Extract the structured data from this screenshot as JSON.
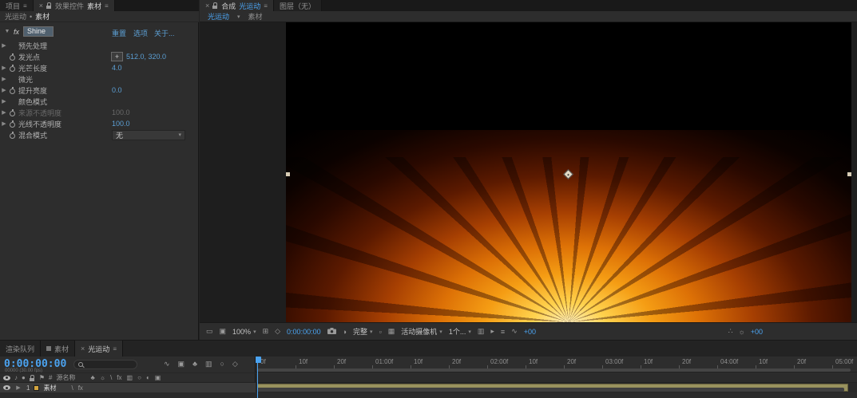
{
  "colors": {
    "accent": "#4ba3f0",
    "value_blue": "#5c9fd4",
    "layer_bar": "#99925e",
    "label_yellow": "#d3a53f",
    "glow_core": "#fff3c8",
    "glow_orange": "#f59d14"
  },
  "icons": {
    "menu": "≡",
    "close": "×",
    "twirl_open": "▼",
    "twirl_closed": "▶",
    "chevron": "▾",
    "bullet": "•",
    "crosshair": "+",
    "screen": "▭",
    "monitor": "▣",
    "grid": "⊞",
    "mask": "◇",
    "snapshot_show": "◎",
    "channels": "◑",
    "roi": "▫",
    "transp": "▦",
    "pixel": "▥",
    "fast": "▸",
    "tl_btn": "≡",
    "flowchart": "∿",
    "mini_flow": "∿",
    "draft3d": "▣",
    "shy": "♣",
    "blend_sw": "▥",
    "mblur": "○",
    "graph": "◇",
    "audio": "♪",
    "solo": "●",
    "flag": "⚑",
    "hash": "#",
    "quality": "\\",
    "fx": "fx",
    "collapse": "☼",
    "adj": "◐",
    "cube": "▣",
    "histogram": "∴",
    "gear": "☼"
  },
  "left": {
    "project_tab": "项目",
    "effects_tab_title": "效果控件",
    "effects_tab_target": "素材",
    "breadcrumb": {
      "comp": "光运动",
      "sep": "•",
      "layer": "素材"
    },
    "effect": {
      "fx_badge": "fx",
      "name": "Shine",
      "links": [
        {
          "label": "重置"
        },
        {
          "label": "选项"
        },
        {
          "label": "关于..."
        }
      ],
      "rows": [
        {
          "label": "预先处理",
          "type": "group",
          "arrow": true,
          "stopwatch": false
        },
        {
          "label": "发光点",
          "type": "point",
          "arrow": false,
          "stopwatch": true,
          "value": "512.0, 320.0"
        },
        {
          "label": "光芒长度",
          "type": "value",
          "arrow": true,
          "stopwatch": true,
          "value": "4.0"
        },
        {
          "label": "微光",
          "type": "group",
          "arrow": true,
          "stopwatch": false
        },
        {
          "label": "提升亮度",
          "type": "value",
          "arrow": true,
          "stopwatch": true,
          "value": "0.0"
        },
        {
          "label": "颜色模式",
          "type": "group",
          "arrow": true,
          "stopwatch": false
        },
        {
          "label": "来源不透明度",
          "type": "value",
          "arrow": true,
          "stopwatch": true,
          "value": "100.0",
          "dimmed": true
        },
        {
          "label": "光线不透明度",
          "type": "value",
          "arrow": true,
          "stopwatch": true,
          "value": "100.0"
        },
        {
          "label": "混合模式",
          "type": "dropdown",
          "arrow": false,
          "stopwatch": true,
          "value": "无"
        }
      ]
    }
  },
  "comp": {
    "tab_title": "合成",
    "tab_comp_name": "光运动",
    "tab_layer": "图层（无）",
    "viewer_tabs": {
      "active": "光运动",
      "other": "素材"
    },
    "toolbar": {
      "zoom": "100%",
      "timecode": "0:00:00:00",
      "resolution": "完整",
      "camera_view": "活动摄像机",
      "view_layout": "1个...",
      "exposure": "+00",
      "exposure_right": "+00"
    }
  },
  "bottom_tabs": {
    "render_queue": "渲染队列",
    "footage": "素材",
    "comp": "光运动"
  },
  "timeline": {
    "timecode": "0:00:00:00",
    "subtext": "00000 (30.00 fps)",
    "source_name": "源名称",
    "layer": {
      "index": "1",
      "name": "素材"
    },
    "ruler_labels": [
      "0f",
      "10f",
      "20f",
      "01:00f",
      "10f",
      "20f",
      "02:00f",
      "10f",
      "20f",
      "03:00f",
      "10f",
      "20f",
      "04:00f",
      "10f",
      "20f",
      "05:00f"
    ]
  }
}
